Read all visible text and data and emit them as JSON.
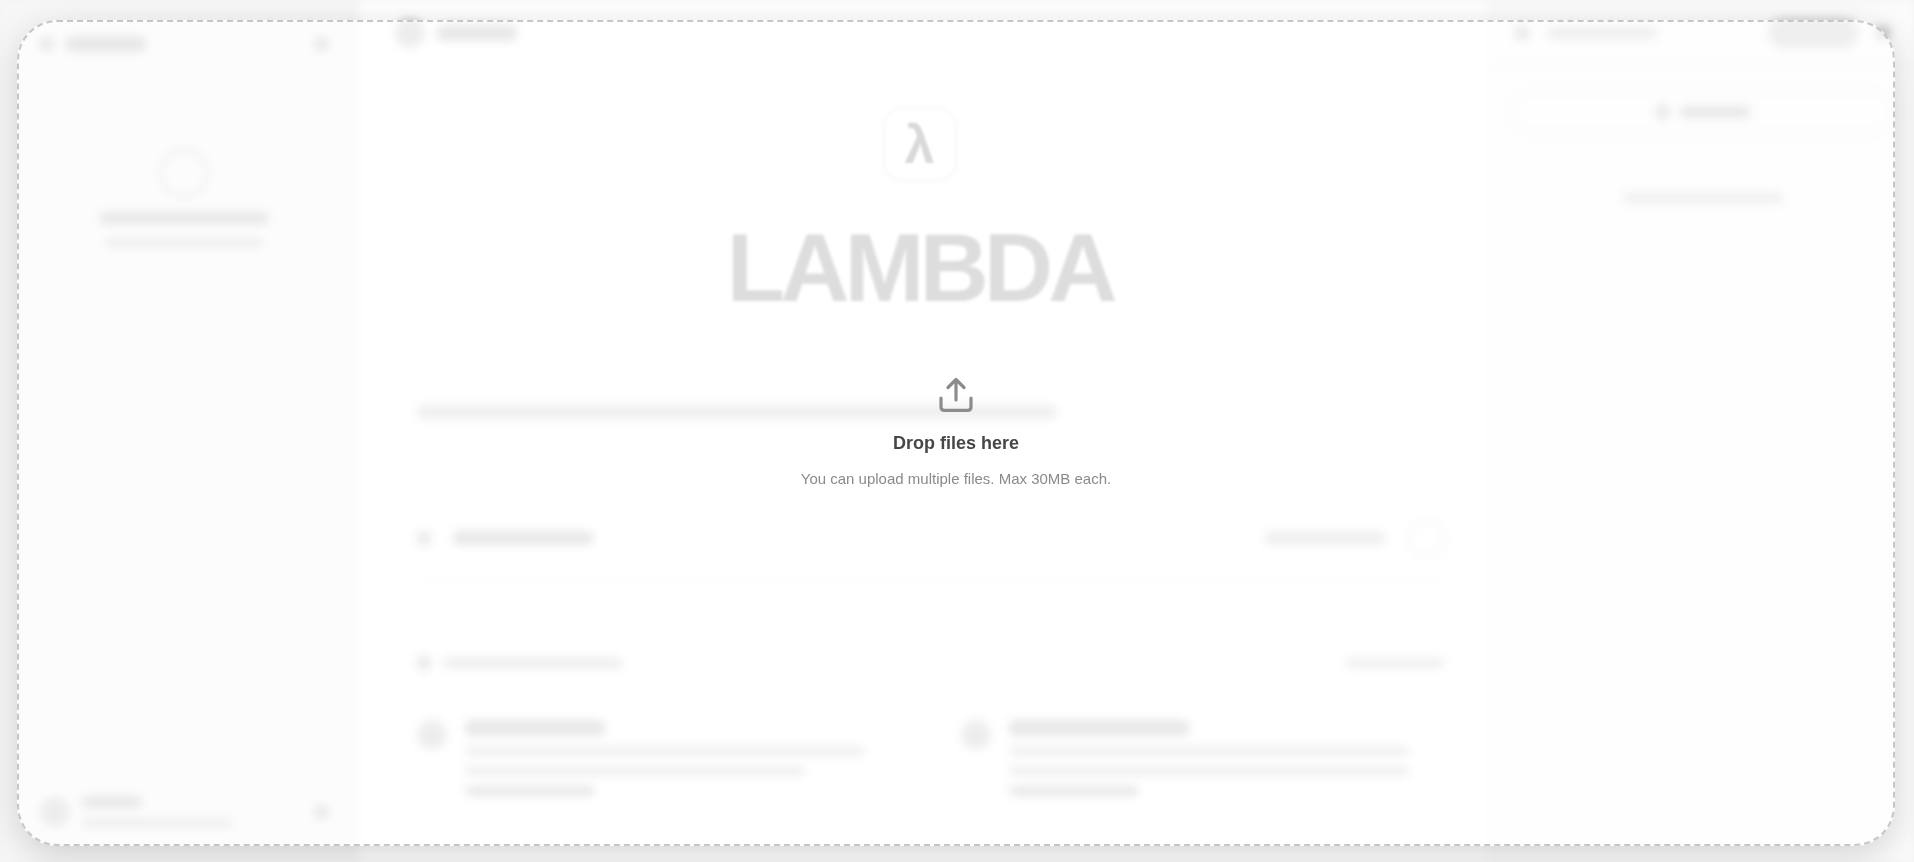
{
  "background": {
    "logo_icon": "λ",
    "logo_text": "LAMBDA"
  },
  "drop_overlay": {
    "title": "Drop files here",
    "subtitle": "You can upload multiple files. Max 30MB each."
  }
}
